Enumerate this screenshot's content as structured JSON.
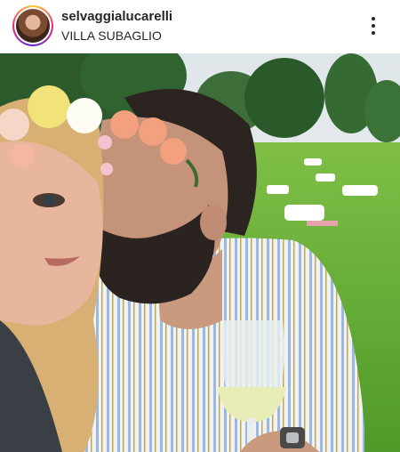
{
  "post": {
    "username": "selvaggialucarelli",
    "location": "VILLA SUBAGLIO"
  },
  "icons": {
    "avatar": "profile-avatar",
    "more": "more-vertical-icon"
  },
  "colors": {
    "text": "#262626",
    "background": "#ffffff",
    "story_ring_start": "#f9ce34",
    "story_ring_end": "#6228d7"
  }
}
